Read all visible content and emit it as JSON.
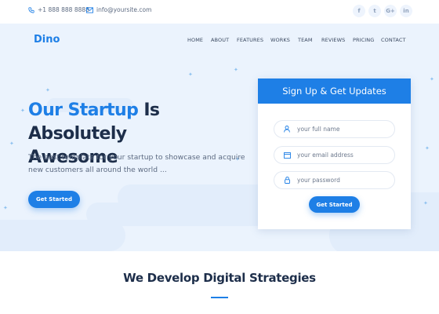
{
  "topbar": {
    "phone": "+1 888 888 8888",
    "email": "info@yoursite.com",
    "social": [
      "f",
      "t",
      "G+",
      "in"
    ],
    "social_icons": [
      "facebook-icon",
      "twitter-icon",
      "google-plus-icon",
      "linkedin-icon"
    ]
  },
  "brand": {
    "logo": "Dino"
  },
  "nav": {
    "items": [
      "HOME",
      "ABOUT",
      "FEATURES",
      "WORKS",
      "TEAM",
      "REVIEWS",
      "PRICING",
      "CONTACT"
    ]
  },
  "hero": {
    "headline_accent": "Our Startup",
    "headline_rest": " Is Absolutely",
    "headline_line2": "Awesome",
    "description": "The best template for your startup to showcase and acquire new customers all around the world ...",
    "cta_label": "Get Started"
  },
  "signup": {
    "title": "Sign Up & Get Updates",
    "fields": [
      {
        "placeholder": "your full name",
        "value": "",
        "icon": "user-icon"
      },
      {
        "placeholder": "your email address",
        "value": "",
        "icon": "email-icon"
      },
      {
        "placeholder": "your password",
        "value": "",
        "icon": "lock-icon"
      }
    ],
    "submit_label": "Get Started"
  },
  "section": {
    "title": "We Develop Digital Strategies"
  },
  "colors": {
    "accent": "#1e7fe6",
    "hero_bg": "#ebf3fd",
    "heading": "#1d2e4a"
  }
}
